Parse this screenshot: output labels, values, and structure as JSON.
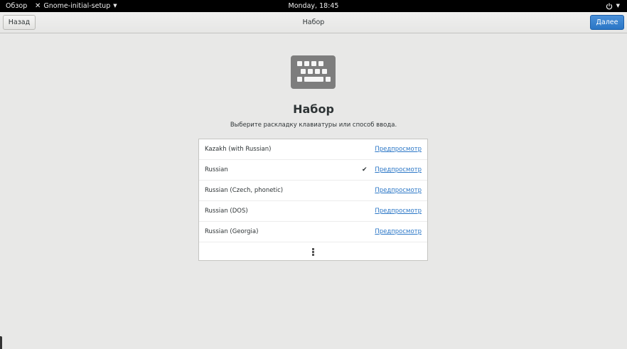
{
  "topbar": {
    "overview": "Обзор",
    "app_name": "Gnome-initial-setup",
    "clock": "Monday, 18:45"
  },
  "header": {
    "back_label": "Назад",
    "title": "Набор",
    "next_label": "Далее",
    "next_color": "#2a76c6"
  },
  "page": {
    "icon": "keyboard-icon",
    "title": "Набор",
    "subtitle": "Выберите раскладку клавиатуры или способ ввода."
  },
  "layouts": [
    {
      "name": "Kazakh (with Russian)",
      "selected": false,
      "preview": "Предпросмотр"
    },
    {
      "name": "Russian",
      "selected": true,
      "preview": "Предпросмотр"
    },
    {
      "name": "Russian (Czech, phonetic)",
      "selected": false,
      "preview": "Предпросмотр"
    },
    {
      "name": "Russian (DOS)",
      "selected": false,
      "preview": "Предпросмотр"
    },
    {
      "name": "Russian (Georgia)",
      "selected": false,
      "preview": "Предпросмотр"
    }
  ],
  "check_glyph": "✔"
}
